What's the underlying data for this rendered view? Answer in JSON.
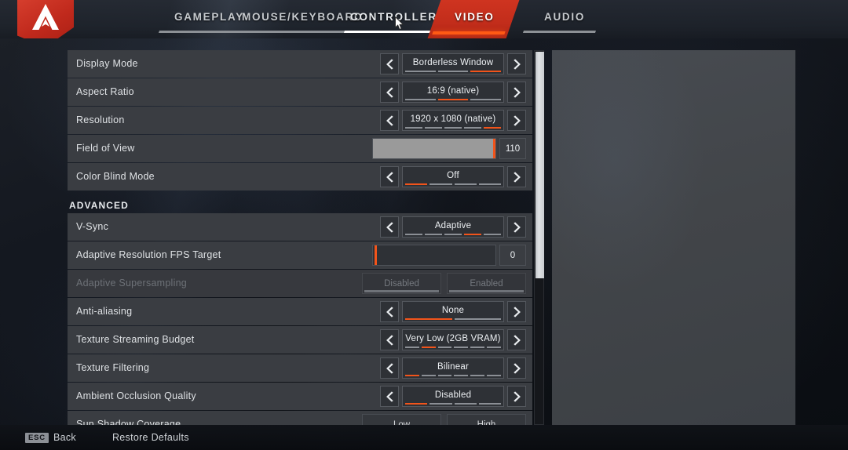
{
  "app": {
    "logo_icon": "apex-legends-logo-icon",
    "accent_orange": "#f2541b",
    "accent_red": "#c22d1b"
  },
  "header": {
    "tabs": [
      {
        "label": "GAMEPLAY",
        "state": "inactive"
      },
      {
        "label": "MOUSE/KEYBOARD",
        "state": "inactive"
      },
      {
        "label": "CONTROLLER",
        "state": "focused"
      },
      {
        "label": "VIDEO",
        "state": "active"
      },
      {
        "label": "AUDIO",
        "state": "inactive"
      }
    ]
  },
  "settings": {
    "basic_rows": [
      {
        "label": "Display Mode",
        "type": "stepper",
        "value": "Borderless Window",
        "segments": 3,
        "selected_index": 2,
        "prev_icon": "chevron-left-icon",
        "next_icon": "chevron-right-icon"
      },
      {
        "label": "Aspect Ratio",
        "type": "stepper",
        "value": "16:9 (native)",
        "segments": 3,
        "selected_index": 1,
        "prev_icon": "chevron-left-icon",
        "next_icon": "chevron-right-icon"
      },
      {
        "label": "Resolution",
        "type": "stepper",
        "value": "1920 x 1080 (native)",
        "segments": 5,
        "selected_index": 4,
        "prev_icon": "chevron-left-icon",
        "next_icon": "chevron-right-icon"
      },
      {
        "label": "Field of View",
        "type": "slider",
        "value": "110",
        "fill_percent": 100
      },
      {
        "label": "Color Blind Mode",
        "type": "stepper",
        "value": "Off",
        "segments": 4,
        "selected_index": 0,
        "prev_icon": "chevron-left-icon",
        "next_icon": "chevron-right-icon"
      }
    ],
    "advanced_header": "ADVANCED",
    "advanced_rows": [
      {
        "label": "V-Sync",
        "type": "stepper",
        "value": "Adaptive",
        "segments": 5,
        "selected_index": 3,
        "prev_icon": "chevron-left-icon",
        "next_icon": "chevron-right-icon"
      },
      {
        "label": "Adaptive Resolution FPS Target",
        "type": "slider",
        "value": "0",
        "fill_percent": 0
      },
      {
        "label": "Adaptive Supersampling",
        "type": "toggle",
        "disabled": true,
        "options": [
          "Disabled",
          "Enabled"
        ],
        "selected_index": 0
      },
      {
        "label": "Anti-aliasing",
        "type": "stepper",
        "value": "None",
        "segments": 2,
        "selected_index": 0,
        "prev_icon": "chevron-left-icon",
        "next_icon": "chevron-right-icon"
      },
      {
        "label": "Texture Streaming Budget",
        "type": "stepper",
        "value": "Very Low (2GB VRAM)",
        "segments": 6,
        "selected_index": 1,
        "prev_icon": "chevron-left-icon",
        "next_icon": "chevron-right-icon"
      },
      {
        "label": "Texture Filtering",
        "type": "stepper",
        "value": "Bilinear",
        "segments": 6,
        "selected_index": 0,
        "prev_icon": "chevron-left-icon",
        "next_icon": "chevron-right-icon"
      },
      {
        "label": "Ambient Occlusion Quality",
        "type": "stepper",
        "value": "Disabled",
        "segments": 4,
        "selected_index": 0,
        "prev_icon": "chevron-left-icon",
        "next_icon": "chevron-right-icon"
      },
      {
        "label": "Sun Shadow Coverage",
        "type": "toggle",
        "disabled": false,
        "options": [
          "Low",
          "High"
        ],
        "selected_index": -1
      }
    ]
  },
  "scrollbar": {
    "thumb_top_percent": 0,
    "thumb_height_percent": 61
  },
  "footer": {
    "back_key": "ESC",
    "back_label": "Back",
    "restore_defaults_label": "Restore Defaults"
  }
}
